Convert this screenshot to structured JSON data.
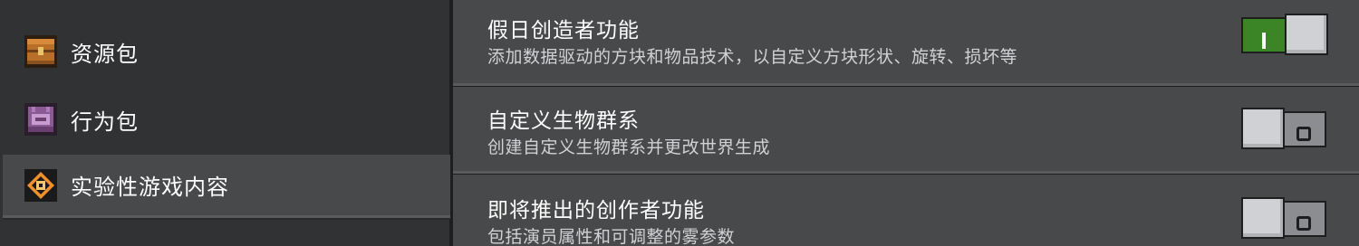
{
  "sidebar": {
    "items": [
      {
        "label": "资源包",
        "icon": "resource-pack-icon",
        "selected": false
      },
      {
        "label": "行为包",
        "icon": "behavior-pack-icon",
        "selected": false
      },
      {
        "label": "实验性游戏内容",
        "icon": "experimental-gameplay-icon",
        "selected": true
      }
    ]
  },
  "settings": [
    {
      "title": "假日创造者功能",
      "description": "添加数据驱动的方块和物品技术，以自定义方块形状、旋转、损坏等",
      "enabled": true
    },
    {
      "title": "自定义生物群系",
      "description": "创建自定义生物群系并更改世界生成",
      "enabled": false
    },
    {
      "title": "即将推出的创作者功能",
      "description": "包括演员属性和可调整的雾参数",
      "enabled": false
    }
  ],
  "colors": {
    "toggle_on": "#3c8527",
    "toggle_off": "#8c8d90",
    "panel": "#48494a",
    "sidebar": "#313233",
    "background": "#1e1e1f"
  }
}
